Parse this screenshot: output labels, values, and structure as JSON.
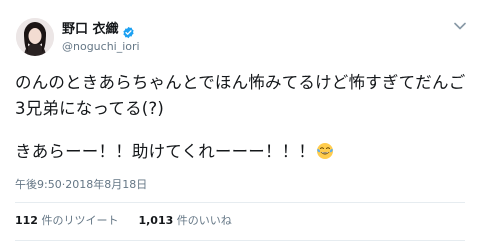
{
  "author": {
    "display_name": "野口 衣織",
    "handle": "@noguchi_iori",
    "avatar_icon": "person-photo",
    "verified_icon": "verified-badge-icon",
    "verified_color": "#1da1f2"
  },
  "tweet": {
    "line1": "のんのときあらちゃんとでほん怖みてるけど怖すぎてだんご3兄弟になってる(?)",
    "line2": "きあらーー！！助けてくれーーー！！！",
    "emoji_icon": "face-with-tears-of-joy-icon"
  },
  "meta": {
    "time": "午後9:50",
    "separator": " · ",
    "date": "2018年8月18日"
  },
  "stats": {
    "retweets_count": "112",
    "retweets_label": " 件のリツイート",
    "likes_count": "1,013",
    "likes_label": " 件のいいね"
  },
  "colors": {
    "text": "#14171a",
    "secondary": "#657786",
    "divider": "#e6ecf0"
  }
}
